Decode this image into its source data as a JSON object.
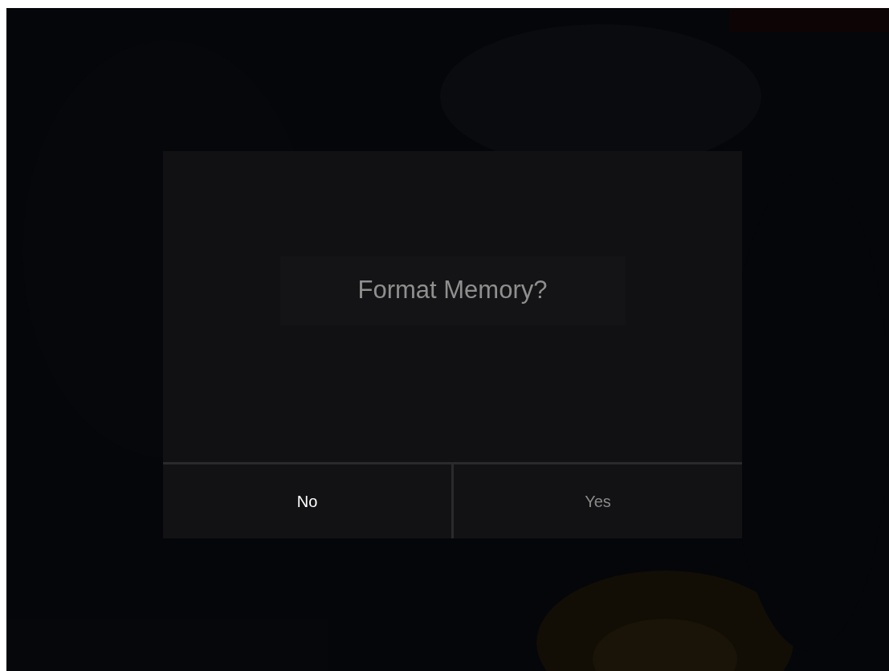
{
  "dialog": {
    "message": "Format Memory?",
    "buttons": [
      {
        "label": "No",
        "selected": true
      },
      {
        "label": "Yes",
        "selected": false
      }
    ]
  }
}
